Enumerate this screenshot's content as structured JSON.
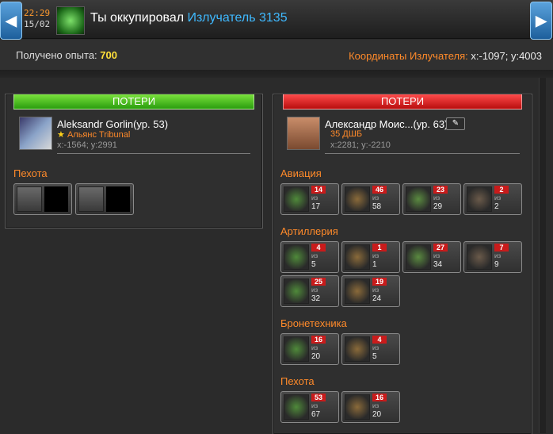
{
  "header": {
    "time": "22:29",
    "date": "15/02",
    "title_prefix": "Ты оккупировал",
    "title_target": "Излучатель 3135"
  },
  "info": {
    "xp_label": "Получено опыта:",
    "xp_value": "700",
    "coords_label": "Координаты Излучателя:",
    "coords_value": "x:-1097; y:4003"
  },
  "left": {
    "header": "ПОТЕРИ",
    "player": {
      "name": "Aleksandr Gorlin(ур. 53)",
      "alliance": "Альянс Tribunal",
      "coords": "x:-1564; y:2991"
    },
    "category": "Пехота"
  },
  "right": {
    "header": "ПОТЕРИ",
    "player": {
      "name": "Александр Моис...(ур. 63)",
      "alliance": "35 ДШБ",
      "coords": "x:2281; y:-2210"
    },
    "categories": {
      "aviation": "Авиация",
      "artillery": "Артиллерия",
      "armor": "Бронетехника",
      "infantry": "Пехота"
    },
    "of_label": "из",
    "units": {
      "aviation": [
        {
          "lost": "14",
          "total": "17"
        },
        {
          "lost": "46",
          "total": "58"
        },
        {
          "lost": "23",
          "total": "29"
        },
        {
          "lost": "2",
          "total": "2"
        }
      ],
      "artillery": [
        {
          "lost": "4",
          "total": "5"
        },
        {
          "lost": "1",
          "total": "1"
        },
        {
          "lost": "27",
          "total": "34"
        },
        {
          "lost": "7",
          "total": "9"
        },
        {
          "lost": "25",
          "total": "32"
        },
        {
          "lost": "19",
          "total": "24"
        }
      ],
      "armor": [
        {
          "lost": "16",
          "total": "20"
        },
        {
          "lost": "4",
          "total": "5"
        }
      ],
      "infantry": [
        {
          "lost": "53",
          "total": "67"
        },
        {
          "lost": "16",
          "total": "20"
        }
      ]
    }
  }
}
